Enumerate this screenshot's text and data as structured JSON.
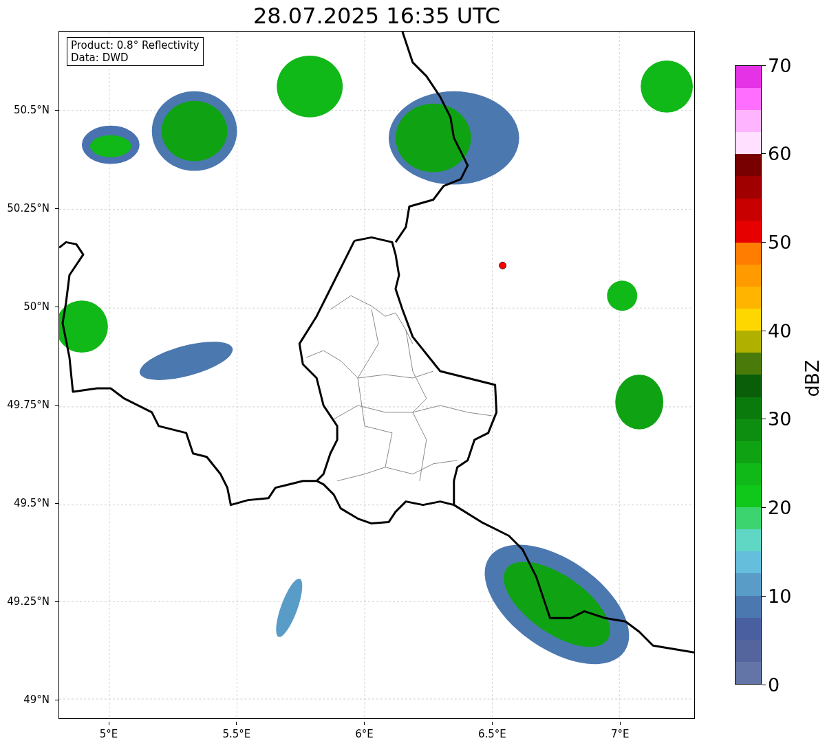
{
  "title": "28.07.2025 16:35 UTC",
  "legend": [
    "Product: 0.8° Reflectivity",
    "Data: DWD"
  ],
  "x_axis": {
    "ticks": [
      "5°E",
      "5.5°E",
      "6°E",
      "6.5°E",
      "7°E"
    ]
  },
  "y_axis": {
    "ticks": [
      "50.5°N",
      "50.25°N",
      "50°N",
      "49.75°N",
      "49.5°N",
      "49.25°N",
      "49°N"
    ]
  },
  "colorbar": {
    "label": "dBZ",
    "ticks": [
      "70",
      "60",
      "50",
      "40",
      "30",
      "20",
      "10",
      "0"
    ]
  }
}
